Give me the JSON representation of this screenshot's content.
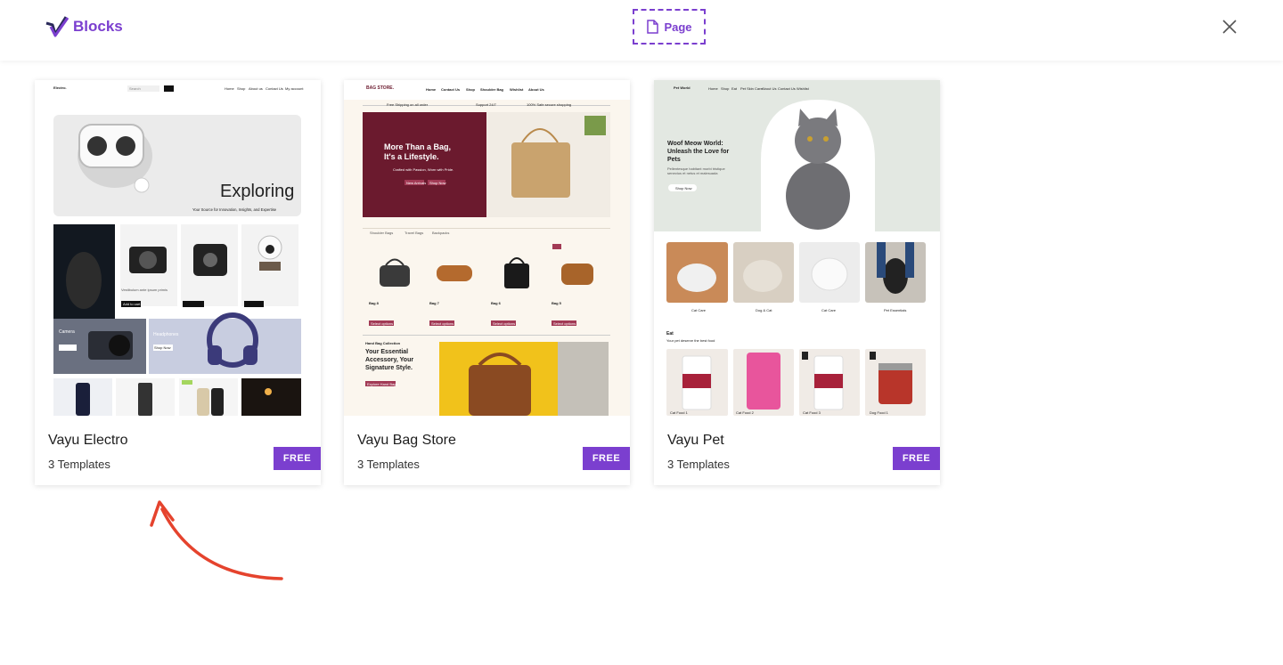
{
  "header": {
    "brand": "Blocks",
    "page_tab": "Page"
  },
  "cards": [
    {
      "title": "Vayu Electro",
      "subtitle": "3 Templates",
      "badge": "FREE",
      "preview": {
        "logo": "Electro.",
        "search": "Search",
        "nav": [
          "Home",
          "Shop",
          "About us",
          "Contact Us",
          "My account"
        ],
        "hero_title": "Exploring",
        "hero_sub": "Your Source for Innovation, Insights, and Expertise",
        "product_caption": "Vestibulum ante ipsum primis",
        "add_to_cart": "Add to cart",
        "banner_left": "Camera",
        "banner_right": "Headphones",
        "shop_now": "Shop Now"
      }
    },
    {
      "title": "Vayu Bag Store",
      "subtitle": "3 Templates",
      "badge": "FREE",
      "preview": {
        "logo": "BAG STORE.",
        "nav": [
          "Home",
          "Contact Us",
          "Shop",
          "Shoulder Bag",
          "Wishlist",
          "About Us"
        ],
        "strip": [
          "Free Shipping on all order",
          "Support 24/7",
          "100% Safe secure shopping"
        ],
        "hero_title": "More Than a Bag, It's a Lifestyle.",
        "hero_sub": "Crafted with Passion, Worn with Pride.",
        "btn1": "New Arrivals",
        "btn2": "Shop Now",
        "tabs": [
          "Shoulder Bags",
          "Travel Bags",
          "Backpacks"
        ],
        "bags": [
          "Bag 8",
          "Bag 7",
          "Bag 6",
          "Bag 5"
        ],
        "select": "Select options",
        "collection": "Hand Bag Collection",
        "promo_title": "Your Essential Accessory, Your Signature Style.",
        "promo_btn": "Explore Hand Bags"
      }
    },
    {
      "title": "Vayu Pet",
      "subtitle": "3 Templates",
      "badge": "FREE",
      "preview": {
        "logo": "Pet World",
        "nav": [
          "Home",
          "Shop",
          "Eat",
          "Pet Skin Care",
          "About Us",
          "Contact Us",
          "Wishlist"
        ],
        "hero_title": "Woof Meow World: Unleash the Love for Pets",
        "hero_sub": "Pellentesque habitant morbi tristique senectus et netus et malesuada",
        "hero_btn": "Shop Now",
        "cats": [
          "Cat Care",
          "Dog & Cat",
          "Cat Care",
          "Pet Essentials"
        ],
        "eat": "Eat",
        "eat_sub": "Your pet deserve the best food",
        "foods": [
          "Cat Food 1",
          "Cat Food 2",
          "Cat Food 3",
          "Dog Food 1"
        ]
      }
    }
  ],
  "colors": {
    "accent": "#7b3fcf",
    "arrow": "#e5432d",
    "bag_maroon": "#6b1a2e",
    "pet_bg": "#e3e8e2"
  }
}
